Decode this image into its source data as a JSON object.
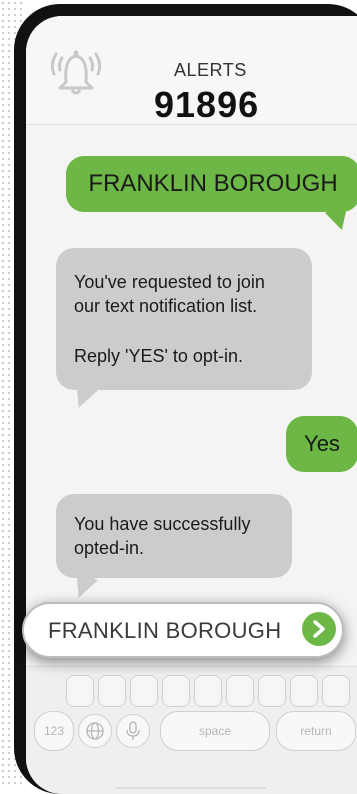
{
  "header": {
    "alerts_label": "ALERTS",
    "shortcode": "91896"
  },
  "messages": [
    {
      "direction": "outgoing",
      "lines": [
        "FRANKLIN BOROUGH"
      ]
    },
    {
      "direction": "incoming",
      "lines": [
        "You've requested to join",
        "our text notification list.",
        "",
        "Reply 'YES' to opt-in."
      ]
    },
    {
      "direction": "outgoing",
      "lines": [
        "Yes"
      ]
    },
    {
      "direction": "incoming",
      "lines": [
        "You have successfully",
        "opted-in."
      ]
    }
  ],
  "composer": {
    "text": "FRANKLIN BOROUGH"
  },
  "keyboard": {
    "numbers_key": "123",
    "space_key": "space",
    "return_key": "return"
  },
  "colors": {
    "outgoing_bubble": "#6cb745",
    "incoming_bubble": "#cccccc",
    "send_button": "#6cb745"
  },
  "icons": [
    "bell-icon",
    "send-arrow-icon",
    "globe-icon",
    "microphone-icon"
  ]
}
